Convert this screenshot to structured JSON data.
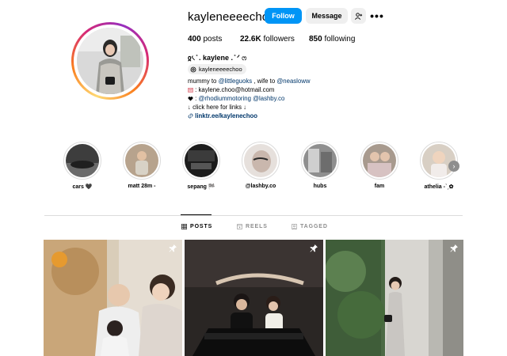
{
  "profile": {
    "username": "kayleneeeechoo",
    "follow_label": "Follow",
    "message_label": "Message",
    "more_label": "•••"
  },
  "stats": {
    "posts_count": "400",
    "posts_label": "posts",
    "followers_count": "22.6K",
    "followers_label": "followers",
    "following_count": "850",
    "following_label": "following"
  },
  "bio": {
    "full_name": "ჲ৻ ̊ . kaylene . ̊ ᐟ ෆ",
    "threads_handle": "kayleneeeechoo",
    "line1_prefix": "mummy to ",
    "line1_link1": "@littleguoks",
    "line1_mid": " , wife to ",
    "line1_link2": "@neasloww",
    "line2_text": " : kaylene.choo@hotmail.com",
    "line3_prefix": " : ",
    "line3_link1": "@rhodiummotoring",
    "line3_link2": "@lashby.co",
    "line4_text": "↓ click here for links ↓",
    "link_url": "linktr.ee/kaylenechoo"
  },
  "highlights": [
    {
      "label": "cars 🖤"
    },
    {
      "label": "matt 28m -"
    },
    {
      "label": "sepang 🏁"
    },
    {
      "label": "@lashby.co"
    },
    {
      "label": "hubs"
    },
    {
      "label": "fam"
    },
    {
      "label": "athelia -ˋˏ✿"
    }
  ],
  "tabs": {
    "posts": "POSTS",
    "reels": "REELS",
    "tagged": "TAGGED"
  },
  "colors": {
    "accent": "#0095f6",
    "link": "#00376b",
    "button_bg": "#efefef",
    "muted": "#8e8e8e"
  },
  "icons": {
    "more": "more-options-icon",
    "add_user": "add-user-icon",
    "threads": "threads-icon",
    "pin": "pinned-icon",
    "link": "link-icon",
    "grid": "grid-icon",
    "reels": "reels-icon",
    "tagged": "tagged-icon",
    "next": "chevron-right-icon"
  }
}
